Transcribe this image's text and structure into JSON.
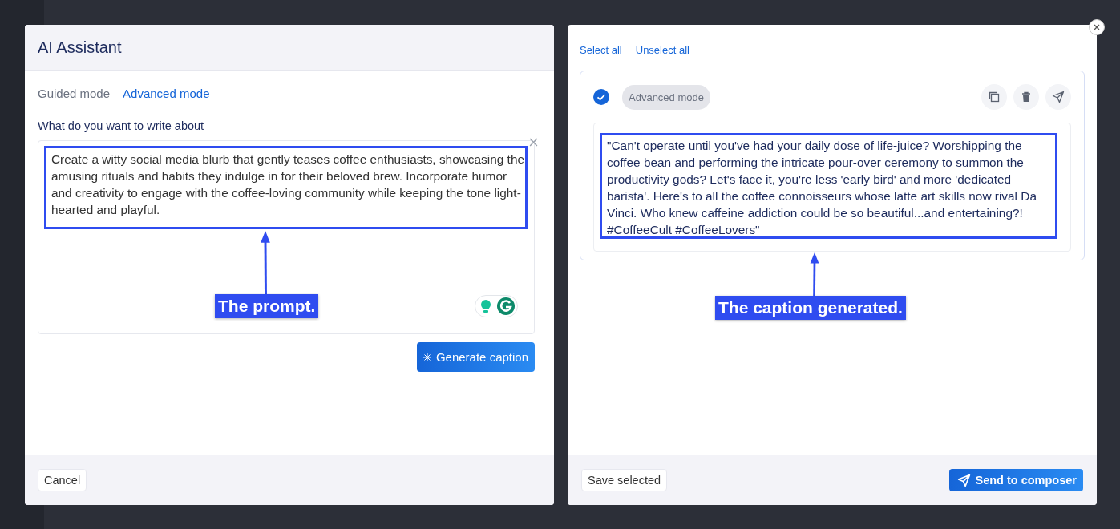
{
  "assistant_dialog": {
    "title": "AI Assistant",
    "tabs": [
      {
        "label": "Guided mode",
        "selected": false
      },
      {
        "label": "Advanced mode",
        "selected": true
      }
    ],
    "prompt_label": "What do you want to write about",
    "prompt_value": "Create a witty social media blurb that gently teases coffee enthusiasts, showcasing the amusing rituals and habits they indulge in for their beloved brew. Incorporate humor and creativity to engage with the coffee-loving community while keeping the tone light-hearted and playful.",
    "annotation": "The prompt.",
    "generate_button": "Generate caption",
    "cancel_button": "Cancel"
  },
  "results_dialog": {
    "select_all": "Select all",
    "unselect_all": "Unselect all",
    "result": {
      "checked": true,
      "mode_tag": "Advanced mode",
      "caption": "\"Can't operate until you've had your daily dose of life-juice? Worshipping the coffee bean and performing the intricate pour-over ceremony to summon the productivity gods? Let's face it, you're less 'early bird' and more 'dedicated barista'. Here's to all the coffee connoisseurs whose latte art skills now rival Da Vinci. Who knew caffeine addiction could be so beautiful...and entertaining?! #CoffeeCult #CoffeeLovers\""
    },
    "annotation": "The caption generated.",
    "save_button": "Save selected",
    "send_button": "Send to composer"
  }
}
